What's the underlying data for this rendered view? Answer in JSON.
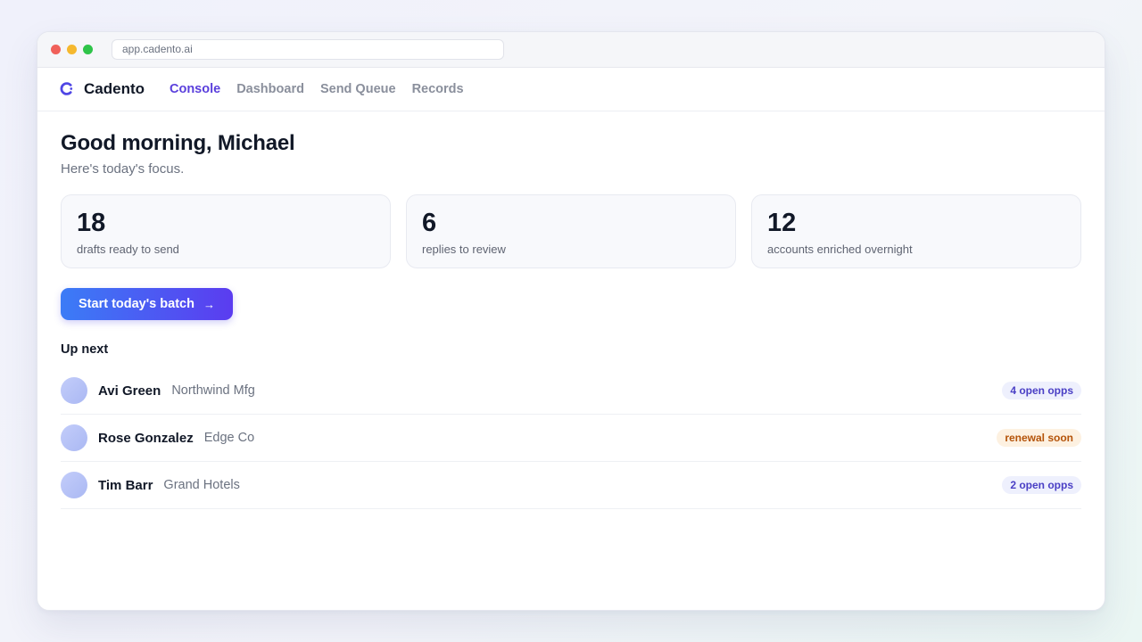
{
  "browser": {
    "url": "app.cadento.ai"
  },
  "nav": {
    "brand": "Cadento",
    "links": [
      {
        "label": "Console",
        "active": true
      },
      {
        "label": "Dashboard",
        "active": false
      },
      {
        "label": "Send Queue",
        "active": false
      },
      {
        "label": "Records",
        "active": false
      }
    ]
  },
  "main": {
    "greeting": "Good morning, Michael",
    "subtitle": "Here's today's focus.",
    "stats": [
      {
        "value": "18",
        "label": "drafts ready to send"
      },
      {
        "value": "6",
        "label": "replies to review"
      },
      {
        "value": "12",
        "label": "accounts enriched overnight"
      }
    ],
    "cta_label": "Start today's batch",
    "cta_arrow": "→",
    "up_next_title": "Up next",
    "up_next": [
      {
        "name": "Avi Green",
        "company": "Northwind Mfg",
        "badge": "4 open opps",
        "badge_tone": "blue"
      },
      {
        "name": "Rose Gonzalez",
        "company": "Edge Co",
        "badge": "renewal soon",
        "badge_tone": "amber"
      },
      {
        "name": "Tim Barr",
        "company": "Grand Hotels",
        "badge": "2 open opps",
        "badge_tone": "blue"
      }
    ]
  },
  "colors": {
    "accent": "#5a3fdc",
    "cta_start": "#3b7cf6",
    "cta_end": "#5b3cf0",
    "badge_blue_text": "#4a3fc5",
    "badge_amber_text": "#b45309"
  },
  "icons": {
    "logo": "cadento-logo-icon",
    "cta": "arrow-right-icon"
  }
}
